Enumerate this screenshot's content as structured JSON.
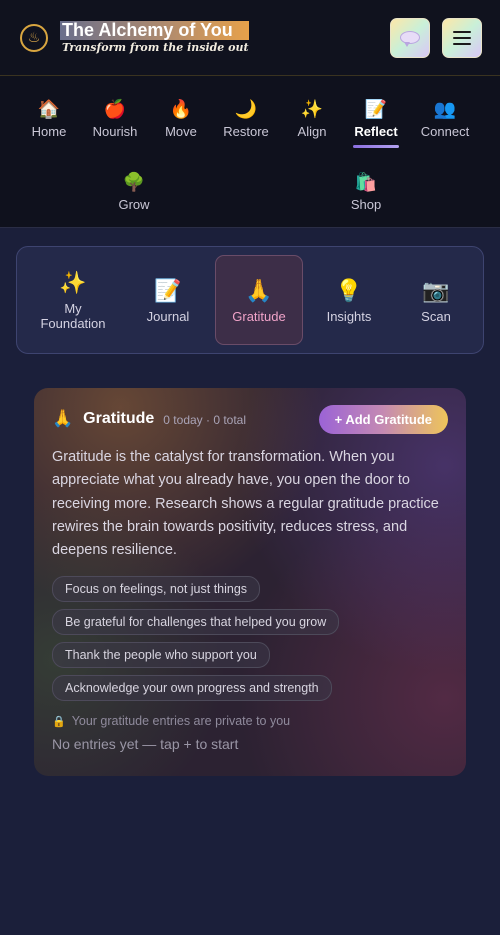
{
  "header": {
    "logo_icon": "lotus-flame-icon",
    "title": "The Alchemy of You",
    "subtitle": "Transform from the inside out",
    "chat_button_icon": "chat-bubble-icon",
    "menu_button_icon": "hamburger-menu-icon"
  },
  "nav": {
    "items": [
      {
        "label": "Home",
        "icon": "🏠"
      },
      {
        "label": "Nourish",
        "icon": "🍎"
      },
      {
        "label": "Move",
        "icon": "🔥"
      },
      {
        "label": "Restore",
        "icon": "🌙"
      },
      {
        "label": "Align",
        "icon": "✨"
      },
      {
        "label": "Reflect",
        "icon": "📝"
      },
      {
        "label": "Connect",
        "icon": "👥"
      },
      {
        "label": "Grow",
        "icon": "🌳"
      },
      {
        "label": "Shop",
        "icon": "🛍️"
      }
    ],
    "active": "Reflect"
  },
  "tabs": {
    "items": [
      {
        "label": "My Foundation",
        "icon": "✨"
      },
      {
        "label": "Journal",
        "icon": "📝"
      },
      {
        "label": "Gratitude",
        "icon": "🙏"
      },
      {
        "label": "Insights",
        "icon": "💡"
      },
      {
        "label": "Scan",
        "icon": "📷"
      }
    ],
    "active": "Gratitude"
  },
  "card": {
    "icon": "🙏",
    "title": "Gratitude",
    "meta": "0 today · 0 total",
    "add_button": "+ Add Gratitude",
    "description": "Gratitude is the catalyst for transformation. When you appreciate what you already have, you open the door to receiving more. Research shows a regular gratitude practice rewires the brain towards positivity, reduces stress, and deepens resilience.",
    "tips": [
      "Focus on feelings, not just things",
      "Be grateful for challenges that helped you grow",
      "Thank the people who support you",
      "Acknowledge your own progress and strength"
    ],
    "privacy_icon": "🔒",
    "privacy": "Your gratitude entries are private to you",
    "empty": "No entries yet — tap + to start"
  },
  "colors": {
    "background": "#1b1f3a",
    "accent_purple": "#9b63d6",
    "accent_gold": "#eec55a",
    "active_tab_text": "#f1a3c9"
  }
}
